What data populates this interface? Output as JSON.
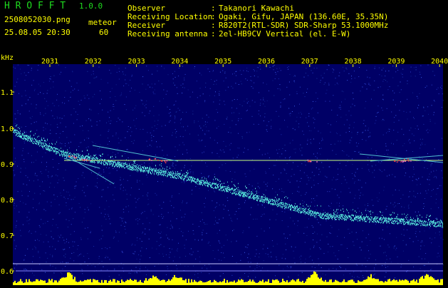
{
  "header": {
    "app_name": "H R O F F T",
    "version": "1.0.0",
    "filename": "2508052030.png",
    "datetime": "25.08.05 20:30",
    "meteor_label": "meteor",
    "meteor_count": "60",
    "fields": [
      {
        "label": "Observer",
        "sep": ":",
        "value": "Takanori Kawachi"
      },
      {
        "label": "Receiving Location",
        "sep": ":",
        "value": "Ogaki, Gifu, JAPAN (136.60E, 35.35N)"
      },
      {
        "label": "Receiver",
        "sep": ":",
        "value": "R820T2(RTL-SDR) SDR-Sharp 53.1000MHz"
      },
      {
        "label": "Receiving antenna",
        "sep": ":",
        "value": "2el-HB9CV Vertical (el. E-W)"
      }
    ]
  },
  "spectrogram": {
    "unit_label": "kHz",
    "time_ticks": [
      "2031",
      "2032",
      "2033",
      "2034",
      "2035",
      "2036",
      "2037",
      "2038",
      "2039",
      "2040"
    ],
    "freq_ticks": [
      "1.1",
      "1.0",
      "0.9",
      "0.8",
      "0.7",
      "0.6"
    ],
    "colors": {
      "background": "#000066",
      "label_yellow": "#ffff00",
      "label_green": "#1fdc1f",
      "trace": "#40c0c0",
      "meteor_line": "#c8ff80",
      "echo_hot": "#ff4040",
      "histogram": "#ffff00"
    }
  }
}
